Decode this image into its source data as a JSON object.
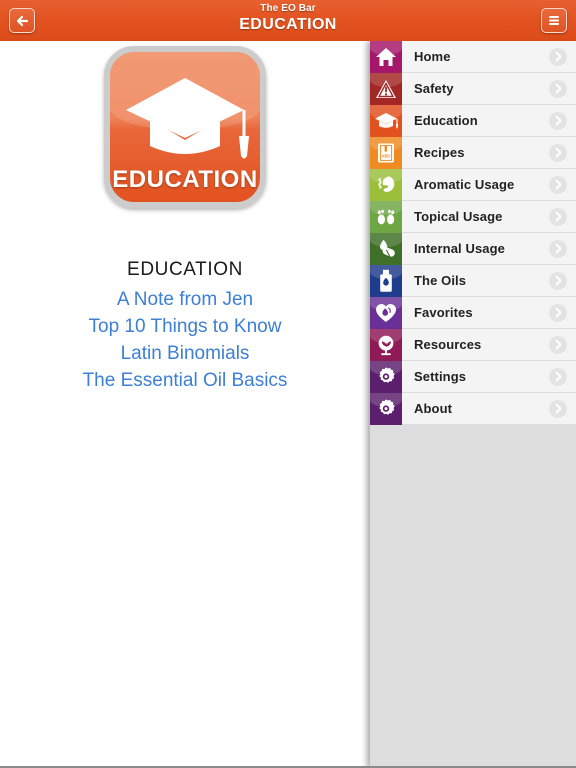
{
  "header": {
    "subtitle": "The EO Bar",
    "title": "EDUCATION",
    "back_icon": "back-arrow-icon",
    "menu_icon": "hamburger-menu-icon",
    "background_color": "#e2521f"
  },
  "main": {
    "logo": {
      "icon": "graduation-cap-icon",
      "word": "EDUCATION",
      "tile_color": "#e2521f",
      "border_color": "#cccccc"
    },
    "section_title": "EDUCATION",
    "link_color": "#3c7fd4",
    "links": [
      {
        "label": "A Note from Jen"
      },
      {
        "label": "Top 10 Things to Know"
      },
      {
        "label": "Latin Binomials"
      },
      {
        "label": "The Essential Oil Basics"
      }
    ]
  },
  "sidebar": {
    "chevron_icon": "chevron-right-icon",
    "background_color": "#dddddd",
    "items": [
      {
        "label": "Home",
        "icon": "house-icon",
        "color": "#a5176b"
      },
      {
        "label": "Safety",
        "icon": "warning-triangle-icon",
        "color": "#a32724"
      },
      {
        "label": "Education",
        "icon": "graduation-cap-icon",
        "color": "#e2521f"
      },
      {
        "label": "Recipes",
        "icon": "recipe-book-icon",
        "color": "#f08a22"
      },
      {
        "label": "Aromatic Usage",
        "icon": "diffuser-nose-icon",
        "color": "#a6c council"
      },
      {
        "label": "Topical Usage",
        "icon": "feet-icon",
        "color": "#6ea644"
      },
      {
        "label": "Internal Usage",
        "icon": "drop-capsule-icon",
        "color": "#3f7027"
      },
      {
        "label": "The Oils",
        "icon": "oil-bottle-icon",
        "color": "#203c8c"
      },
      {
        "label": "Favorites",
        "icon": "heart-icon",
        "color": "#6a3098"
      },
      {
        "label": "Resources",
        "icon": "globe-leaf-icon",
        "color": "#8e1a56"
      },
      {
        "label": "Settings",
        "icon": "gear-icon",
        "color": "#5c1f6e"
      },
      {
        "label": "About",
        "icon": "gear-icon",
        "color": "#5c1f6e"
      }
    ]
  }
}
